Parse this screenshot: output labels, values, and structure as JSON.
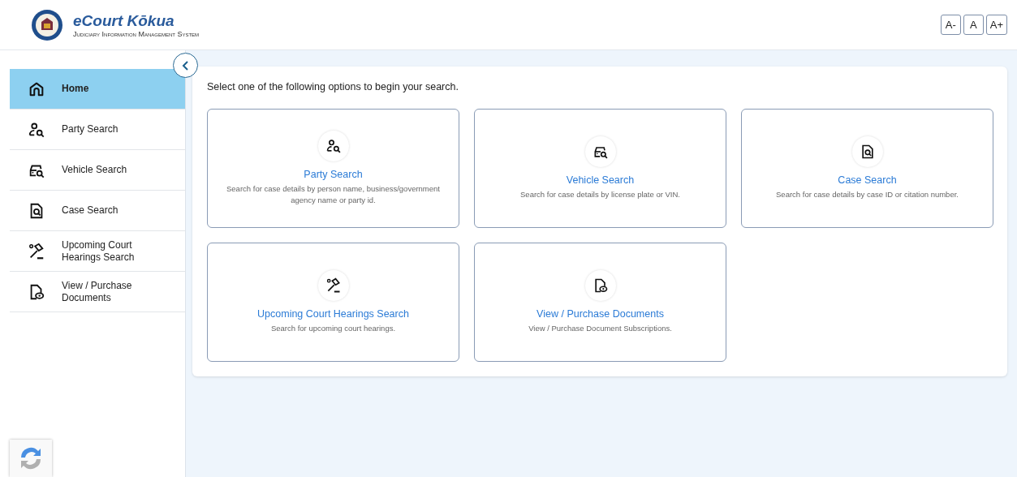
{
  "header": {
    "title": "eCourt Kōkua",
    "subtitle": "Judiciary Information Management System",
    "font_buttons": [
      "A-",
      "A",
      "A+"
    ]
  },
  "sidebar": {
    "items": [
      {
        "label": "Home",
        "kind": "home",
        "selected": true
      },
      {
        "label": "Party Search",
        "kind": "party",
        "selected": false
      },
      {
        "label": "Vehicle Search",
        "kind": "vehicle",
        "selected": false
      },
      {
        "label": "Case Search",
        "kind": "case",
        "selected": false
      },
      {
        "label": "Upcoming Court Hearings Search",
        "kind": "hearings",
        "selected": false
      },
      {
        "label": "View / Purchase Documents",
        "kind": "documents",
        "selected": false
      }
    ]
  },
  "main": {
    "intro": "Select one of the following options to begin your search.",
    "cards": [
      {
        "title": "Party Search",
        "description": "Search for case details by person name, business/government agency name or party id.",
        "kind": "party"
      },
      {
        "title": "Vehicle Search",
        "description": "Search for case details by license plate or VIN.",
        "kind": "vehicle"
      },
      {
        "title": "Case Search",
        "description": "Search for case details by case ID or citation number.",
        "kind": "case"
      },
      {
        "title": "Upcoming Court Hearings Search",
        "description": "Search for upcoming court hearings.",
        "kind": "hearings"
      },
      {
        "title": "View / Purchase Documents",
        "description": "View / Purchase Document Subscriptions.",
        "kind": "documents"
      }
    ]
  }
}
